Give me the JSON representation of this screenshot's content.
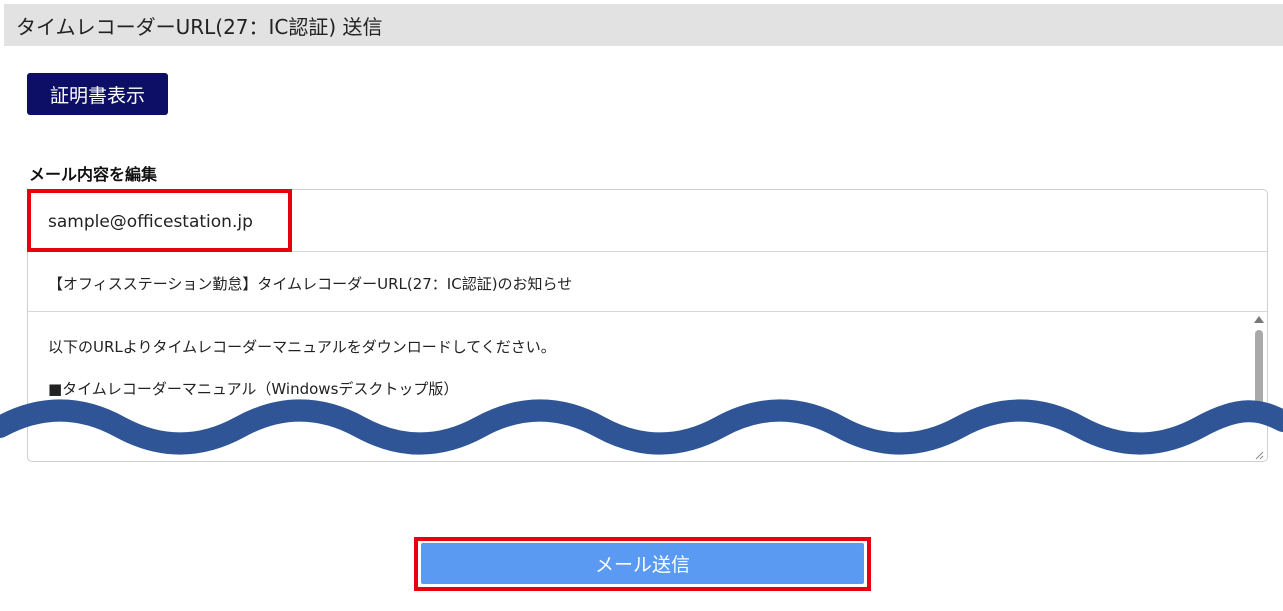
{
  "header": {
    "title": "タイムレコーダーURL(27：IC認証) 送信"
  },
  "toolbar": {
    "cert_button_label": "証明書表示"
  },
  "mail_edit": {
    "section_label": "メール内容を編集",
    "to": "sample@officestation.jp",
    "subject": "【オフィスステーション勤怠】タイムレコーダーURL(27：IC認証)のお知らせ",
    "body_lines": [
      "以下のURLよりタイムレコーダーマニュアルをダウンロードしてください。",
      "■タイムレコーダーマニュアル（Windowsデスクトップ版）"
    ]
  },
  "actions": {
    "send_label": "メール送信"
  },
  "colors": {
    "header_bg": "#e2e2e2",
    "cert_button_bg": "#0d0f66",
    "send_button_bg": "#5b9af2",
    "highlight": "#e60012",
    "wave": "#2f5597"
  }
}
